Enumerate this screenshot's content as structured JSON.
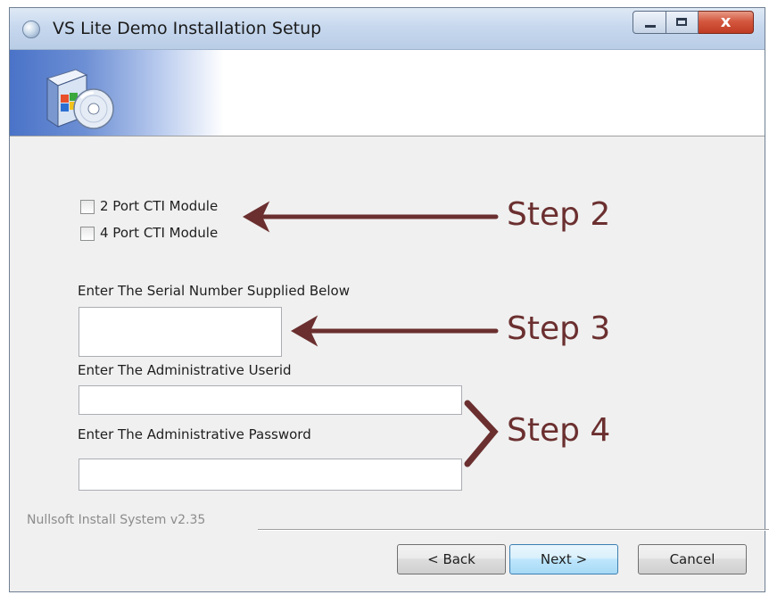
{
  "window": {
    "title": "VS Lite Demo Installation Setup",
    "close_glyph": "x"
  },
  "icons": {
    "app": "installer-globe-icon",
    "header": "software-box-cd-icon",
    "minimize": "minimize-icon",
    "maximize": "maximize-icon",
    "close": "close-icon"
  },
  "form": {
    "checkbox_2port_label": "2 Port CTI Module",
    "checkbox_4port_label": "4 Port CTI Module",
    "checkbox_2port_checked": false,
    "checkbox_4port_checked": false,
    "serial_label": "Enter The Serial Number Supplied Below",
    "serial_value": "",
    "userid_label": "Enter The Administrative Userid",
    "userid_value": "",
    "password_label": "Enter The Administrative Password",
    "password_value": ""
  },
  "footer": {
    "brand_text": "Nullsoft Install System v2.35",
    "back_label": "< Back",
    "next_label": "Next >",
    "cancel_label": "Cancel"
  },
  "annotations": {
    "step2": "Step 2",
    "step3": "Step 3",
    "step4": "Step 4",
    "color": "#6b2f2f"
  },
  "colors": {
    "title_bar": "#c7d8ee",
    "close_button": "#c03b22",
    "dialog_background": "#f0f0f0",
    "banner_blue": "#4a73c8",
    "default_button_border": "#3c7fb1"
  }
}
